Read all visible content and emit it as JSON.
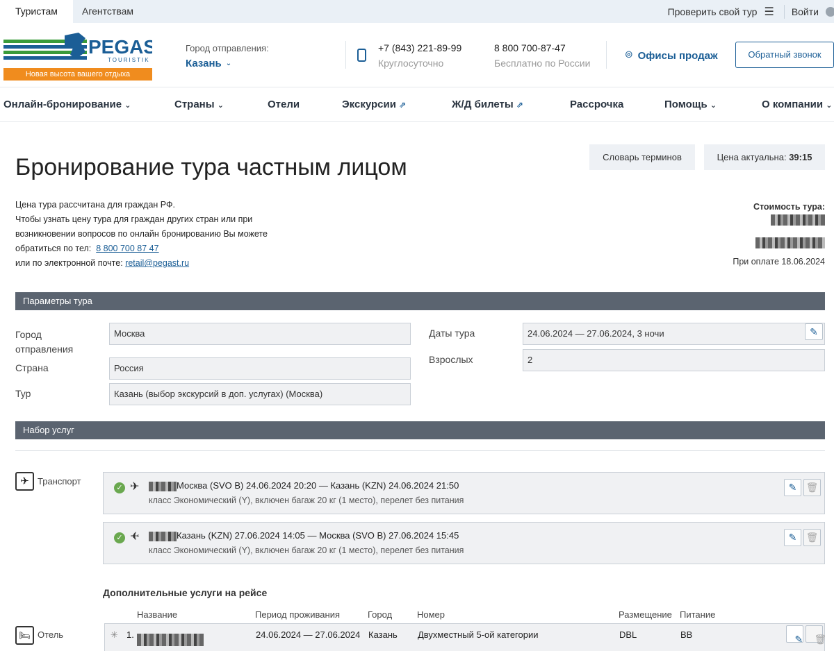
{
  "top": {
    "tab_tourists": "Туристам",
    "tab_agencies": "Агентствам",
    "check_tour": "Проверить свой тур",
    "login": "Войти"
  },
  "header": {
    "logo_text": "PEGAS",
    "logo_sub": "TOURISTIK",
    "slogan": "Новая высота вашего отдыха",
    "city_label": "Город отправления:",
    "city_value": "Казань",
    "phone1": "+7 (843) 221-89-99",
    "phone1_sub": "Круглосуточно",
    "phone2": "8 800 700-87-47",
    "phone2_sub": "Бесплатно по России",
    "offices": "Офисы продаж",
    "callback": "Обратный звонок"
  },
  "nav": [
    "Онлайн-бронирование",
    "Страны",
    "Отели",
    "Экскурсии",
    "Ж/Д билеты",
    "Рассрочка",
    "Помощь",
    "О компании"
  ],
  "page": {
    "title": "Бронирование тура частным лицом",
    "glossary": "Словарь терминов",
    "price_valid_label": "Цена актуальна:",
    "price_valid_timer": "39:15",
    "info_l1": "Цена тура рассчитана для граждан РФ.",
    "info_l2": "Чтобы узнать цену тура для граждан других стран или при",
    "info_l3": "возникновении вопросов по онлайн бронированию Вы можете",
    "info_l4_prefix": "обратиться по тел:",
    "info_phone": "8 800 700 87 47",
    "info_l5_prefix": "или по электронной почте:",
    "info_email": "retail@pegast.ru",
    "cost_label": "Стоимость тура:",
    "payment_note": "При оплате 18.06.2024"
  },
  "params": {
    "section": "Параметры тура",
    "city_label": "Город отправления",
    "city": "Москва",
    "country_label": "Страна",
    "country": "Россия",
    "tour_label": "Тур",
    "tour": "Казань (выбор экскурсий в доп. услугах) (Москва)",
    "dates_label": "Даты тура",
    "dates": "24.06.2024 — 27.06.2024, 3  ночи",
    "adults_label": "Взрослых",
    "adults": "2"
  },
  "services": {
    "section": "Набор услуг",
    "transport_label": "Транспорт",
    "flights": [
      {
        "route": "Москва (SVO B) 24.06.2024 20:20 — Казань (KZN) 24.06.2024 21:50",
        "details": "класс Экономический (Y), включен багаж 20 кг (1 место), перелет без питания"
      },
      {
        "route": "Казань (KZN) 27.06.2024 14:05 — Москва (SVO B) 27.06.2024 15:45",
        "details": "класс Экономический (Y), включен багаж 20 кг (1 место), перелет без питания"
      }
    ],
    "extra_title": "Дополнительные услуги на рейсе",
    "hotel_label": "Отель",
    "hotel_headers": {
      "name": "Название",
      "period": "Период проживания",
      "city": "Город",
      "room": "Номер",
      "placement": "Размещение",
      "meal": "Питание"
    },
    "hotel": {
      "num": "1.",
      "period": "24.06.2024 — 27.06.2024",
      "city": "Казань",
      "room": "Двухместный 5-ой категории",
      "placement": "DBL",
      "meal": "BB"
    }
  },
  "colors": {
    "brand_blue": "#1b5e96",
    "brand_orange": "#f08c1e",
    "brand_green": "#3a9b3a",
    "section_bg": "#5b6470"
  }
}
